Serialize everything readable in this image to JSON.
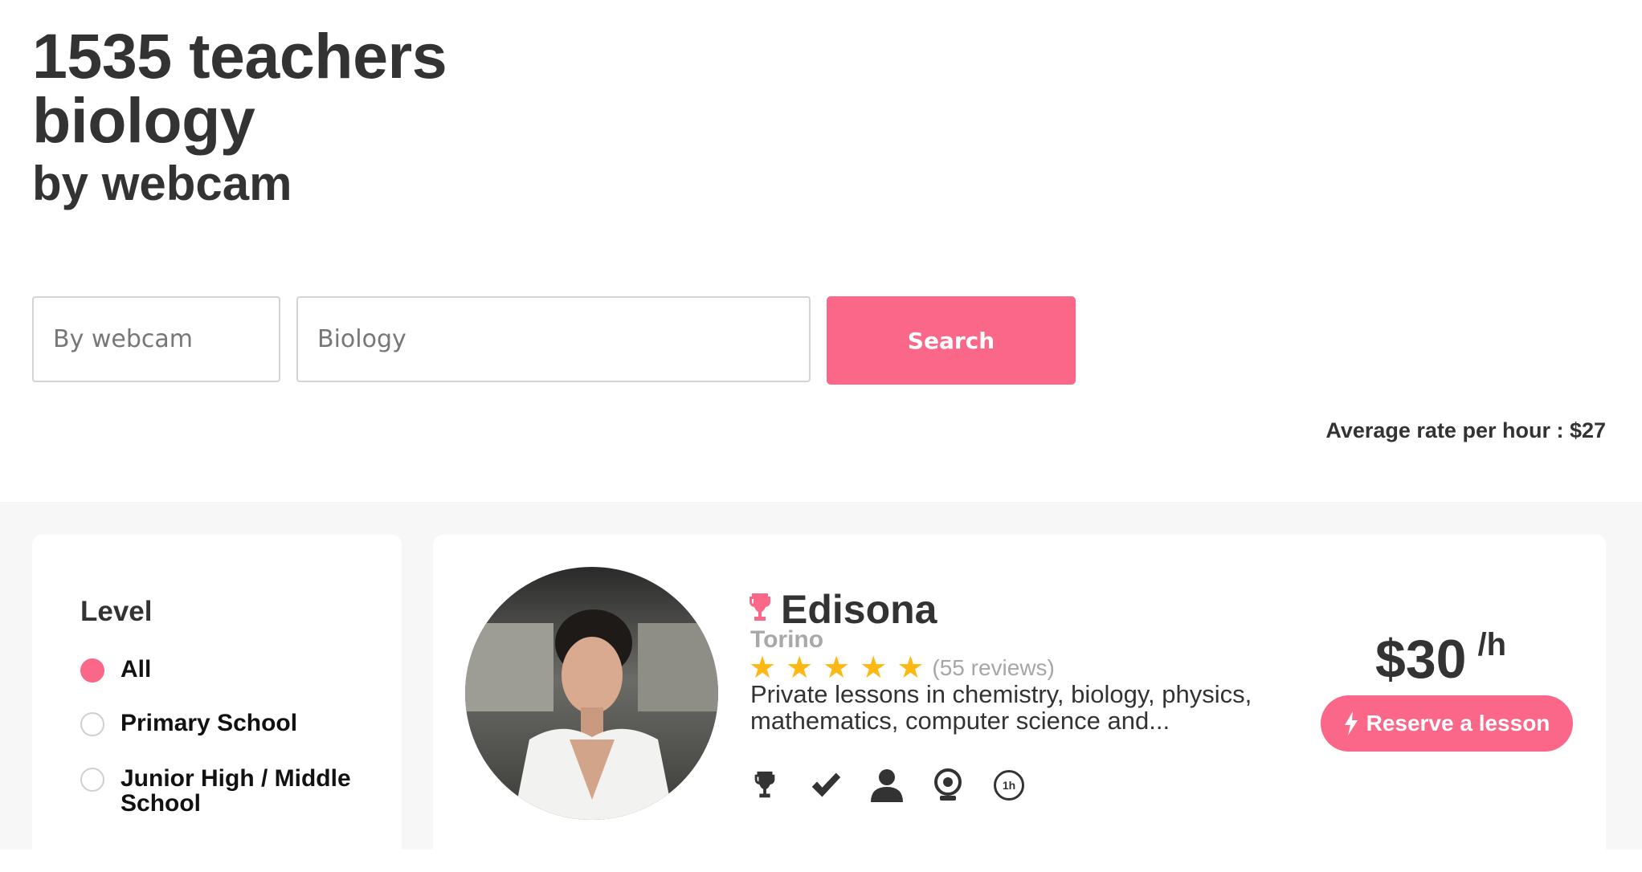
{
  "header": {
    "line1": "1535 teachers",
    "line2": "biology",
    "line3": "by webcam"
  },
  "search": {
    "mode_value": "By webcam",
    "subject_value": "Biology",
    "button_label": "Search"
  },
  "average_rate": "Average rate per hour : $27",
  "filters": {
    "title": "Level",
    "options": [
      {
        "label": "All",
        "selected": true
      },
      {
        "label": "Primary School",
        "selected": false
      },
      {
        "label": "Junior High / Middle School",
        "selected": false
      }
    ]
  },
  "teacher": {
    "name": "Edisona",
    "city": "Torino",
    "rating": 5,
    "reviews": "(55 reviews)",
    "description": "Private lessons in chemistry, biology, physics, mathematics, computer science and...",
    "price": "$30",
    "per": "/h",
    "reserve_label": "Reserve a lesson",
    "badge_icons": [
      "trophy-icon",
      "check-icon",
      "user-icon",
      "webcam-icon",
      "one-hour-icon"
    ],
    "clock_label": "1h"
  },
  "colors": {
    "accent": "#fb6788",
    "star": "#fdb813",
    "text": "#333333",
    "muted": "#a8a8a8",
    "panel_bg": "#f7f7f7"
  }
}
